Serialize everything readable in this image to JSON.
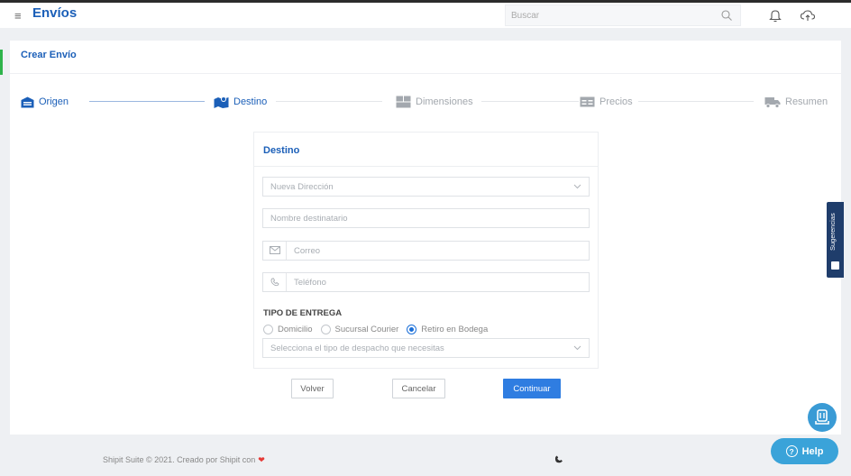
{
  "header": {
    "title": "Envíos",
    "search_placeholder": "Buscar"
  },
  "page": {
    "card_title": "Crear Envío"
  },
  "steps": [
    {
      "label": "Origen",
      "state": "done",
      "icon": "warehouse-icon"
    },
    {
      "label": "Destino",
      "state": "active",
      "icon": "map-marker-icon"
    },
    {
      "label": "Dimensiones",
      "state": "pending",
      "icon": "boxes-icon"
    },
    {
      "label": "Precios",
      "state": "pending",
      "icon": "price-table-icon"
    },
    {
      "label": "Resumen",
      "state": "pending",
      "icon": "truck-icon"
    }
  ],
  "form": {
    "title": "Destino",
    "address_select": "Nueva Dirección",
    "recipient_placeholder": "Nombre destinatario",
    "email_placeholder": "Correo",
    "phone_placeholder": "Teléfono",
    "delivery_heading": "TIPO DE ENTREGA",
    "delivery_options": [
      "Domicilio",
      "Sucursal Courier",
      "Retiro en Bodega"
    ],
    "delivery_selected": "Retiro en Bodega",
    "dispatch_select": "Selecciona el tipo de despacho que necesitas"
  },
  "buttons": {
    "back": "Volver",
    "cancel": "Cancelar",
    "continue": "Continuar"
  },
  "footer": {
    "text": "Shipit Suite © 2021. Creado por Shipit con"
  },
  "widgets": {
    "suggestions": "Sugerencias",
    "help": "Help"
  },
  "colors": {
    "brand_blue": "#1b5fb8",
    "primary_button": "#2f7de1",
    "accent_green": "#2eb34b",
    "help_button": "#3aa3d9",
    "suggestions_tab": "#1f3d6b"
  }
}
